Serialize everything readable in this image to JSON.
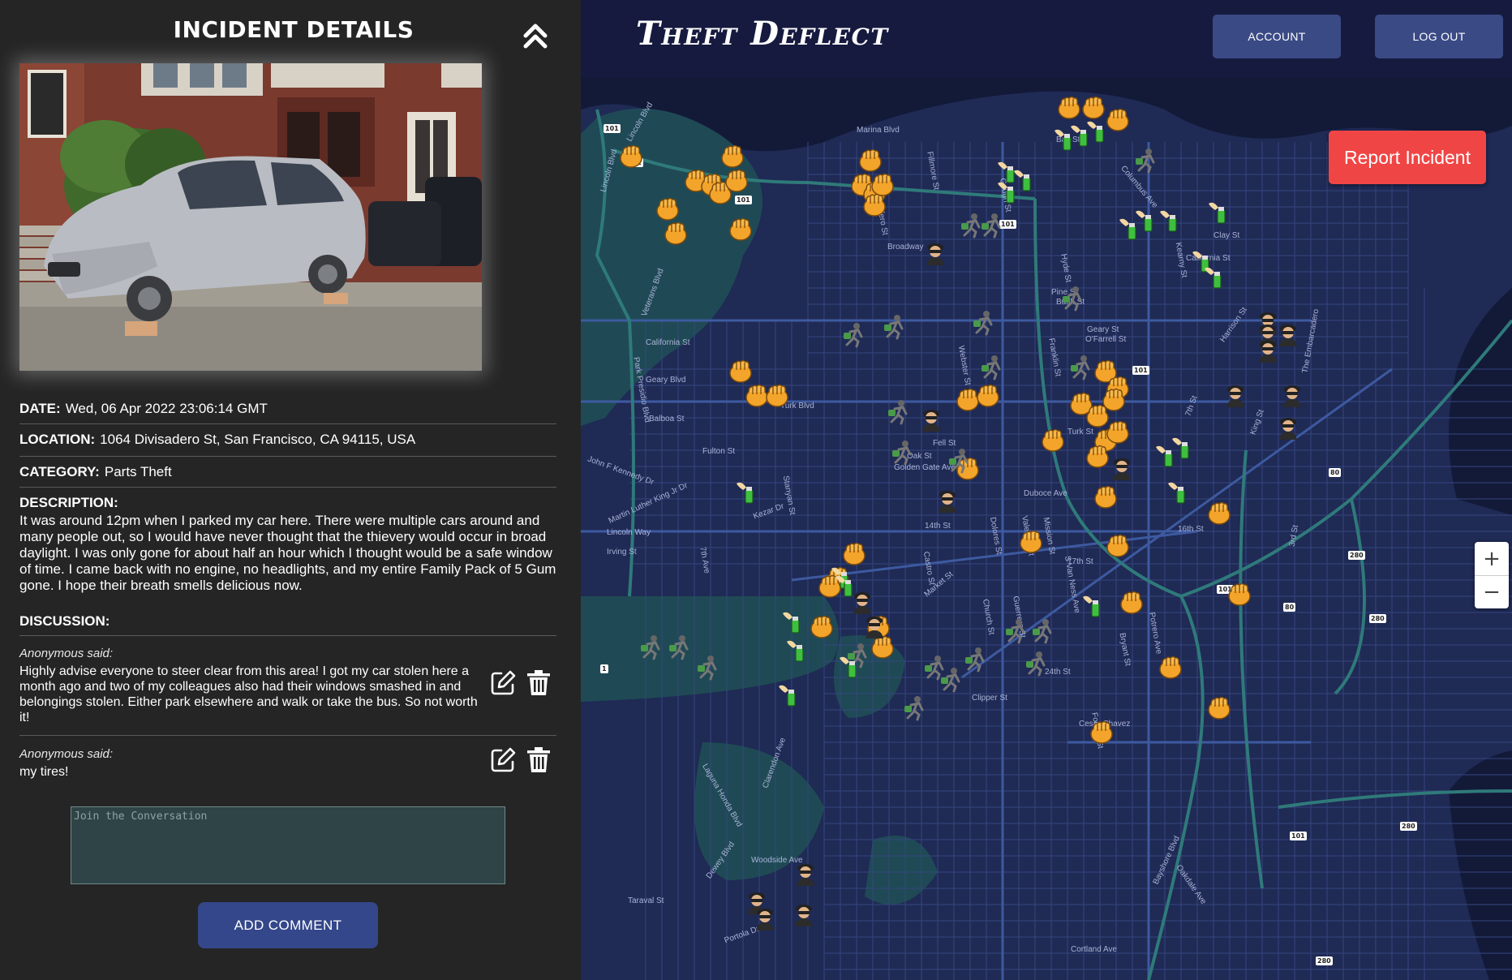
{
  "incident": {
    "panel_title": "INCIDENT DETAILS",
    "date_label": "DATE:",
    "date_value": "Wed, 06 Apr 2022 23:06:14 GMT",
    "location_label": "LOCATION:",
    "location_value": "1064 Divisadero St, San Francisco, CA 94115, USA",
    "category_label": "CATEGORY:",
    "category_value": "Parts Theft",
    "description_label": "DESCRIPTION:",
    "description_value": "It was around 12pm when I parked my car here. There were multiple cars around and many people out, so I would have never thought that the thievery would occur in broad daylight. I was only gone for about half an hour which I thought would be a safe window of time. I came back with no engine, no headlights, and my entire Family Pack of 5 Gum gone. I hope their breath smells delicious now.",
    "discussion_label": "DISCUSSION:"
  },
  "comments": [
    {
      "author": "Anonymous said:",
      "text": "Highly advise everyone to steer clear from this area! I got my car stolen here a month ago and two of my colleagues also had their windows smashed in and belongings stolen. Either park elsewhere and walk or take the bus. So not worth it!"
    },
    {
      "author": "Anonymous said:",
      "text": "my tires!"
    }
  ],
  "comment_form": {
    "placeholder": "Join the Conversation",
    "submit_label": "ADD COMMENT"
  },
  "header": {
    "brand": "Theft Deflect",
    "account_label": "ACCOUNT",
    "logout_label": "LOG OUT"
  },
  "map": {
    "report_label": "Report Incident",
    "zoom_in": "+",
    "zoom_out": "−",
    "streets": [
      "Marina Blvd",
      "Bay St",
      "Lincoln Blvd",
      "Lincoln Blvd",
      "Veterans Blvd",
      "Park Presidio Blvd",
      "California St",
      "Geary Blvd",
      "Balboa St",
      "Fulton St",
      "John F Kennedy Dr",
      "Martin Luther King Jr Dr",
      "Lincoln Way",
      "Irving St",
      "7th Ave",
      "Kezar Dr",
      "Stanyan St",
      "Turk Blvd",
      "Fell St",
      "Oak St",
      "Broadway",
      "Divisadero St",
      "Fillmore St",
      "Webster St",
      "Gough St",
      "Franklin St",
      "Hyde St",
      "Pine St",
      "Bush St",
      "Geary St",
      "O'Farrell St",
      "Turk St",
      "Golden Gate Ave",
      "Market St",
      "14th St",
      "17th St",
      "Castro St",
      "Dolores St",
      "Valencia St",
      "Mission St",
      "Guerrero St",
      "Church St",
      "24th St",
      "Clipper St",
      "Cesar Chavez",
      "Bryant St",
      "Potrero Ave",
      "16th St",
      "3rd St",
      "King St",
      "7th St",
      "Harrison St",
      "Duboce Ave",
      "Columbus Ave",
      "The Embarcadero",
      "Clay St",
      "California St",
      "Kearny St",
      "Folsom St",
      "S Van Ness Ave",
      "Portola Dr",
      "Taraval St",
      "Woodside Ave",
      "Clarendon Ave",
      "Laguna Honda Blvd",
      "Dewey Blvd",
      "Bayshore Blvd",
      "Cortland Ave",
      "Oakdale Ave"
    ],
    "highway_shields": [
      "101",
      "101",
      "101",
      "101",
      "101",
      "101",
      "101",
      "80",
      "80",
      "280",
      "280",
      "280",
      "280",
      "1"
    ],
    "marker_types": [
      "fist-icon",
      "spray-can-icon",
      "burglar-icon",
      "running-thief-icon"
    ]
  }
}
